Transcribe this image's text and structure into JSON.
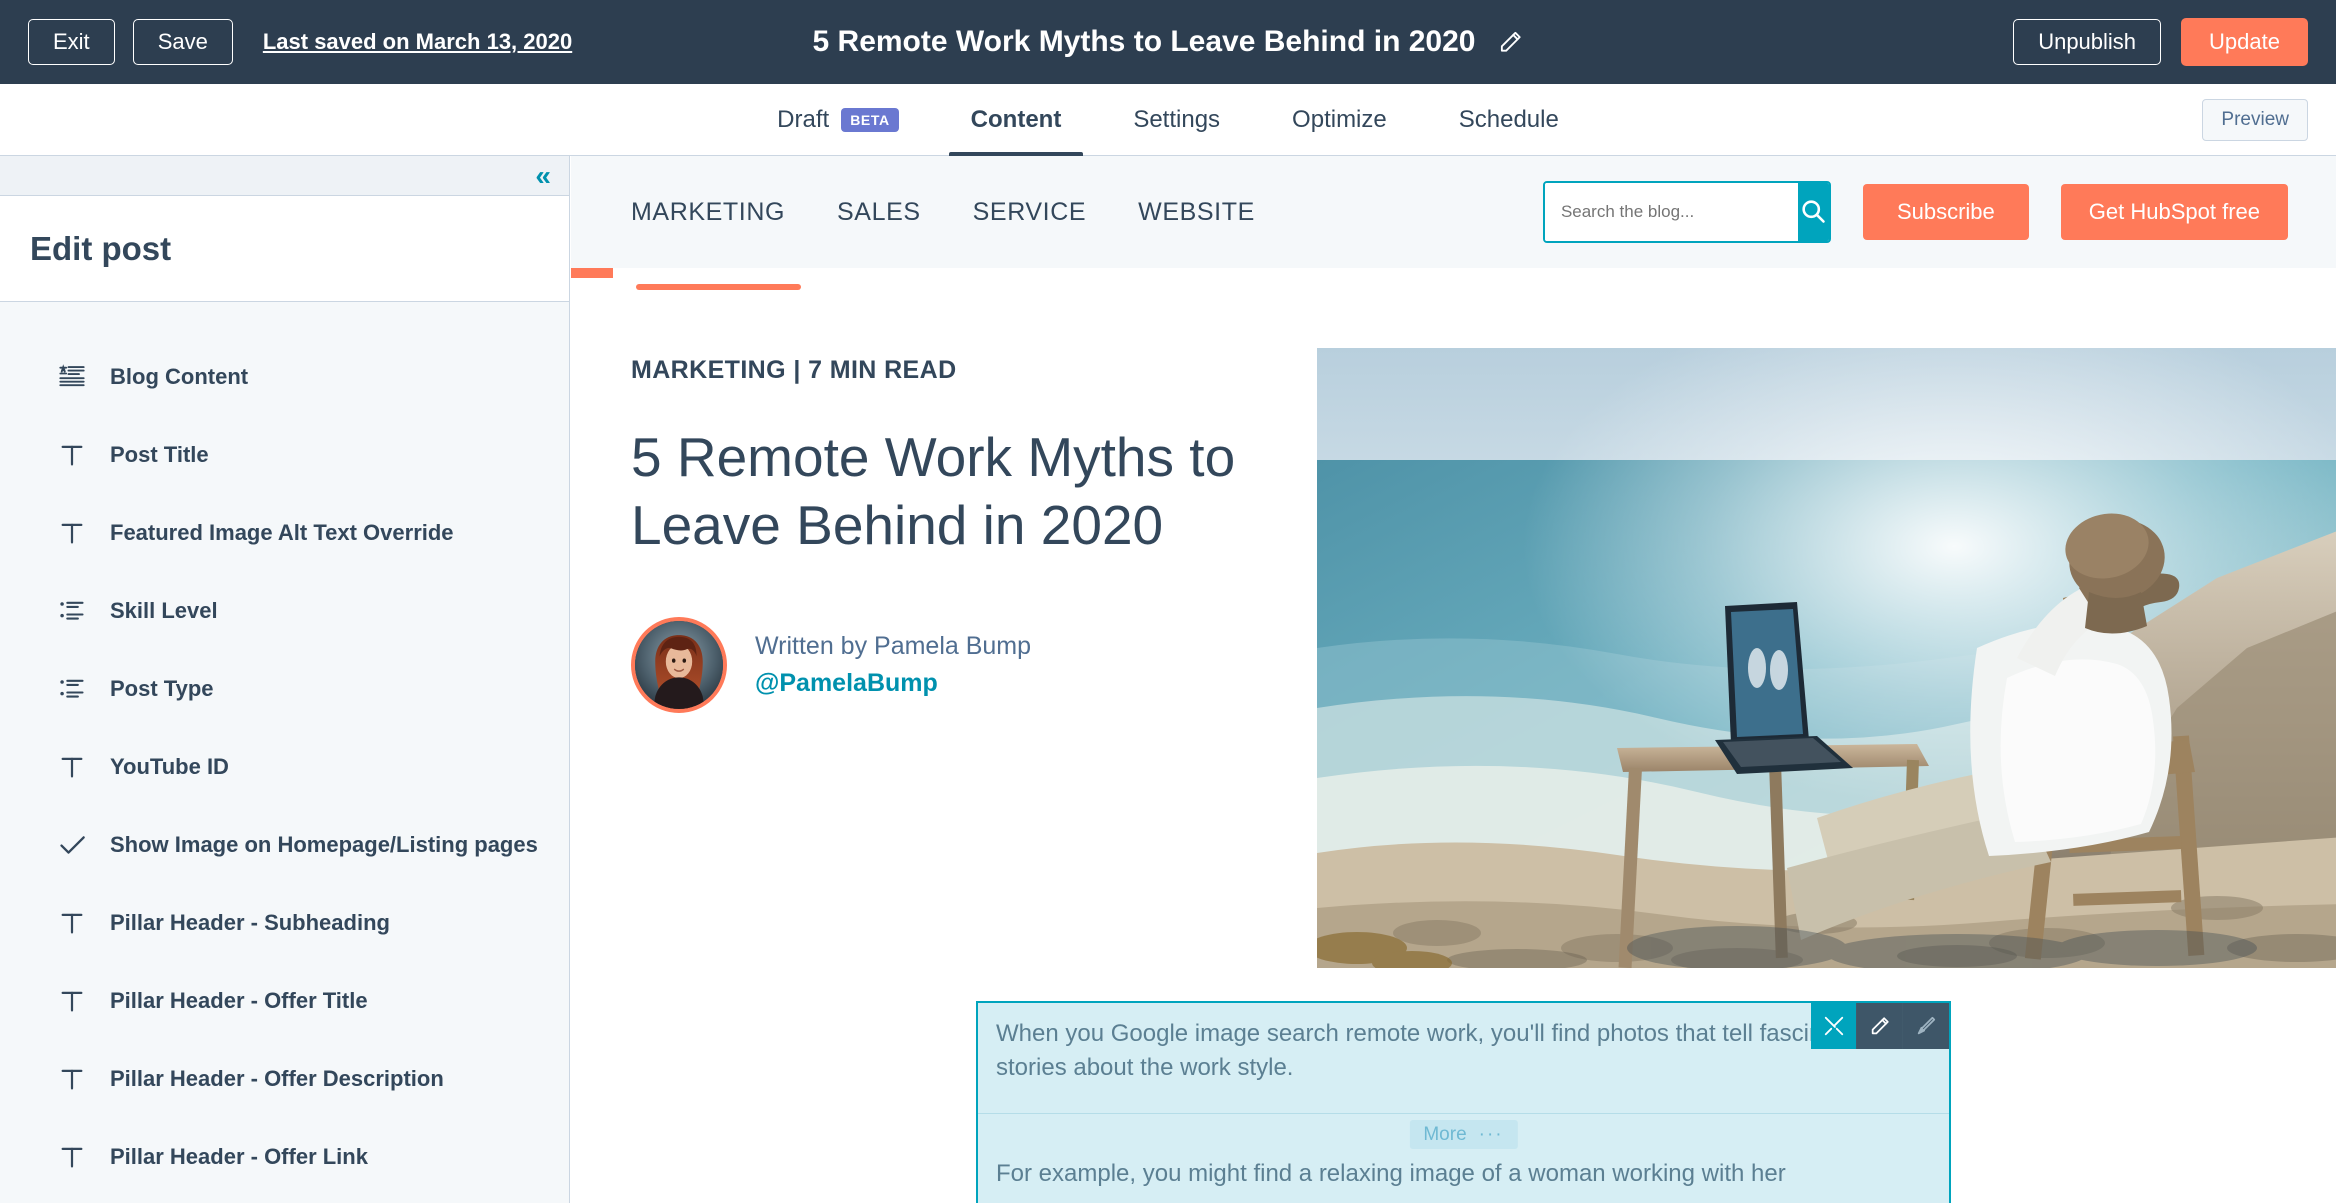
{
  "topbar": {
    "exit_label": "Exit",
    "save_label": "Save",
    "last_saved": "Last saved on March 13, 2020",
    "doc_title": "5 Remote Work Myths to Leave Behind in 2020",
    "edit_title_icon": "pencil-icon",
    "unpublish_label": "Unpublish",
    "update_label": "Update",
    "bg_color": "#2d3e50",
    "accent_color": "#ff7a59"
  },
  "tabbar": {
    "draft_label": "Draft",
    "beta_badge": "BETA",
    "tabs": [
      {
        "label": "Content",
        "active": true
      },
      {
        "label": "Settings",
        "active": false
      },
      {
        "label": "Optimize",
        "active": false
      },
      {
        "label": "Schedule",
        "active": false
      }
    ],
    "preview_label": "Preview"
  },
  "sidebar": {
    "collapse_icon": "«",
    "title": "Edit post",
    "items": [
      {
        "label": "Blog Content",
        "icon": "text-block-icon"
      },
      {
        "label": "Post Title",
        "icon": "text-field-icon"
      },
      {
        "label": "Featured Image Alt Text Override",
        "icon": "text-field-icon"
      },
      {
        "label": "Skill Level",
        "icon": "list-select-icon"
      },
      {
        "label": "Post Type",
        "icon": "list-select-icon"
      },
      {
        "label": "YouTube ID",
        "icon": "text-field-icon"
      },
      {
        "label": "Show Image on Homepage/Listing pages",
        "icon": "checkmark-icon"
      },
      {
        "label": "Pillar Header - Subheading",
        "icon": "text-field-icon"
      },
      {
        "label": "Pillar Header - Offer Title",
        "icon": "text-field-icon"
      },
      {
        "label": "Pillar Header - Offer Description",
        "icon": "text-field-icon"
      },
      {
        "label": "Pillar Header - Offer Link",
        "icon": "text-field-icon"
      }
    ]
  },
  "preview": {
    "blog_nav": {
      "links": [
        "MARKETING",
        "SALES",
        "SERVICE",
        "WEBSITE"
      ],
      "search_placeholder": "Search the blog...",
      "search_value": "",
      "search_icon": "magnifier-icon",
      "subscribe_label": "Subscribe",
      "get_hubspot_label": "Get HubSpot free",
      "button_color": "#ff7a59",
      "search_accent_color": "#00a4bd"
    },
    "article": {
      "eyebrow": "MARKETING | 7 MIN READ",
      "title": "5 Remote Work Myths to Leave Behind in 2020",
      "author_prefix": "Written by Pamela Bump",
      "author_handle": "@PamelaBump",
      "hero_alt": "Person relaxing in a chair at a wooden desk with a laptop on a cliff overlooking the ocean"
    },
    "selected_module": {
      "paragraph_1": "When you Google image search remote work, you'll find photos that tell fascinating stories about the work style.",
      "more_label": "More",
      "more_dots": "···",
      "paragraph_2": "For example, you might find a relaxing image of a woman working with her",
      "toolbar": [
        {
          "name": "tools-icon",
          "state": "primary"
        },
        {
          "name": "pencil-icon",
          "state": "dark"
        },
        {
          "name": "paintbrush-icon",
          "state": "dark"
        }
      ],
      "border_color": "#00a4bd",
      "fill_color": "#d6eef4"
    }
  }
}
